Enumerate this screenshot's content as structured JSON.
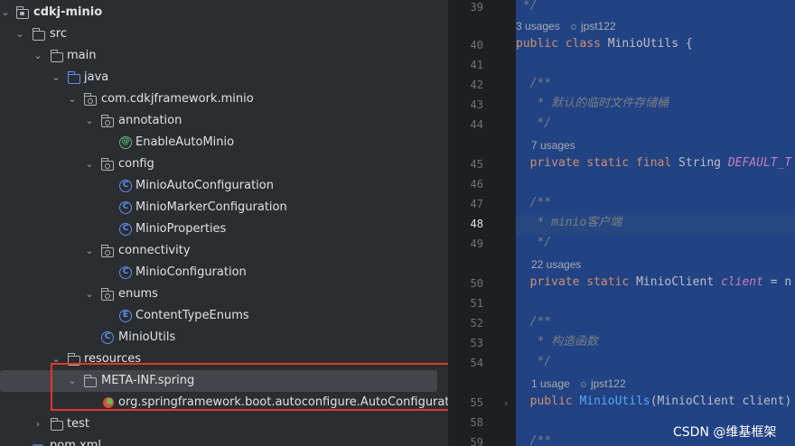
{
  "project_tree": {
    "root": {
      "label": "cdkj-minio"
    },
    "src": "src",
    "main": "main",
    "java": "java",
    "package": "com.cdkjframework.minio",
    "annotation_pkg": "annotation",
    "enable_auto_minio": "EnableAutoMinio",
    "config_pkg": "config",
    "minio_auto_configuration": "MinioAutoConfiguration",
    "minio_marker_configuration": "MinioMarkerConfiguration",
    "minio_properties": "MinioProperties",
    "connectivity_pkg": "connectivity",
    "minio_configuration": "MinioConfiguration",
    "enums_pkg": "enums",
    "content_type_enums": "ContentTypeEnums",
    "minio_utils": "MinioUtils",
    "resources": "resources",
    "meta_inf": "META-INF.spring",
    "auto_config_imports": "org.springframework.boot.autoconfigure.AutoConfiguratic",
    "test": "test",
    "pom": "pom.xml"
  },
  "editor": {
    "line_numbers": [
      "39",
      "40",
      "41",
      "42",
      "43",
      "44",
      "45",
      "46",
      "47",
      "48",
      "49",
      "50",
      "51",
      "52",
      "53",
      "54",
      "55",
      "58",
      "59"
    ],
    "current_line": "48",
    "inlays": {
      "usages_class": "3 usages",
      "author": "jpst122",
      "usages_default": "7 usages",
      "usages_client": "22 usages",
      "usages_ctor": "1 usage",
      "author2": "jpst122"
    },
    "code": {
      "l39": " */",
      "l40_kw": "public class ",
      "l40_name": "MinioUtils {",
      "l42": "  /**",
      "l43": "   * 默认的临时文件存储桶",
      "l44": "   */",
      "l45_kw": "  private static final ",
      "l45_type": "String ",
      "l45_field": "DEFAULT_T",
      "l47": "  /**",
      "l48": "   * minio客户端",
      "l49": "   */",
      "l50_kw": "  private static ",
      "l50_type": "MinioClient ",
      "l50_field": "client",
      "l50_rest": " = n",
      "l52": "  /**",
      "l53": "   * 构造函数",
      "l54": "   */",
      "l55_kw": "  public ",
      "l55_method": "MinioUtils",
      "l55_rest": "(MinioClient client)",
      "l59": "  /**"
    }
  },
  "watermark": "CSDN @维基框架",
  "colors": {
    "highlight_box": "#e5352b",
    "selection": "#214283",
    "tree_bg": "#2b2d30"
  }
}
